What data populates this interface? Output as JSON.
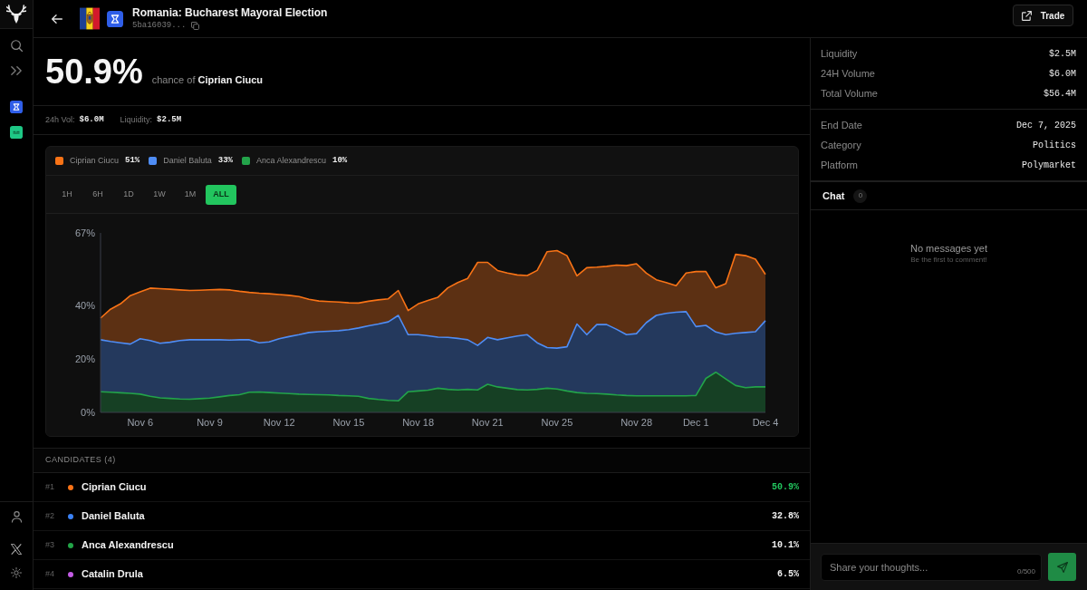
{
  "header": {
    "title": "Romania: Bucharest Mayoral Election",
    "market_id": "5ba16039...",
    "trade_button": "Trade"
  },
  "headline": {
    "probability": "50.9%",
    "caption": "chance of **Ciprian Ciucu**"
  },
  "summary": [
    {
      "label": "24h Vol:",
      "value": "$6.0M"
    },
    {
      "label": "Liquidity:",
      "value": "$2.5M"
    }
  ],
  "chart_card": {
    "legend": [
      {
        "value": "51%"
      },
      {
        "value": "33%"
      },
      {
        "value": "10%"
      }
    ],
    "ranges": [
      {
        "label": "1H",
        "selected": false
      },
      {
        "label": "6H",
        "selected": false
      },
      {
        "label": "1D",
        "selected": false
      },
      {
        "label": "1W",
        "selected": false
      },
      {
        "label": "1M",
        "selected": false
      },
      {
        "label": "ALL",
        "selected": true
      }
    ],
    "chart_data": {
      "type": "area",
      "categories": [
        null,
        null,
        null,
        null,
        "Nov 6",
        null,
        null,
        null,
        null,
        null,
        null,
        "Nov 9",
        null,
        null,
        null,
        null,
        null,
        null,
        "Nov 12",
        null,
        null,
        null,
        null,
        null,
        null,
        "Nov 15",
        null,
        null,
        null,
        null,
        null,
        null,
        "Nov 18",
        null,
        null,
        null,
        null,
        null,
        null,
        "Nov 21",
        null,
        null,
        null,
        null,
        null,
        null,
        "Nov 25",
        null,
        null,
        null,
        null,
        null,
        null,
        null,
        "Nov 28",
        null,
        null,
        null,
        null,
        null,
        "Dec 1",
        null,
        null,
        null,
        null,
        null,
        null,
        "Dec 4"
      ],
      "ylim": [
        0,
        67
      ],
      "yticks": [
        {
          "value": 0,
          "label": "0%"
        },
        {
          "value": 20,
          "label": "20%"
        },
        {
          "value": 40,
          "label": "40%"
        },
        {
          "value": 67,
          "label": "67%"
        }
      ],
      "series": [
        {
          "name": "Ciprian Ciucu",
          "color": "#f97316",
          "values": [
            35.2,
            38.5,
            40.5,
            43.6,
            45,
            46.4,
            46.2,
            46,
            45.7,
            45.5,
            45.6,
            45.8,
            45.9,
            45.7,
            45.2,
            44.8,
            44.5,
            44.3,
            44,
            43.7,
            43.2,
            42.2,
            41.6,
            41.4,
            41.2,
            40.9,
            40.8,
            41.5,
            42,
            42.4,
            45.5,
            38,
            40.5,
            41.8,
            43,
            46.5,
            48.5,
            50,
            56,
            56,
            53,
            52,
            51.3,
            51.1,
            53,
            60,
            60.4,
            58.5,
            51,
            54,
            54.2,
            54.5,
            55,
            54.8,
            55.5,
            52,
            49.5,
            48.5,
            47.3,
            52,
            52.6,
            52.6,
            46.5,
            48,
            59,
            58.5,
            57.2,
            51.5
          ]
        },
        {
          "name": "Daniel Baluta",
          "color": "#4f8df5",
          "values": [
            27.1,
            26.5,
            26,
            25.5,
            27.5,
            26.8,
            25.8,
            26.2,
            26.8,
            27.1,
            27.1,
            27.1,
            27.1,
            27,
            27.1,
            27.1,
            26,
            26.3,
            27.5,
            28.3,
            29,
            29.8,
            30.1,
            30.3,
            30.5,
            30.9,
            31.5,
            32.3,
            33,
            33.8,
            36.2,
            29,
            29,
            28.6,
            28.1,
            28,
            27.6,
            27.1,
            25,
            28,
            27.1,
            27.8,
            28.5,
            29,
            26,
            24.2,
            24,
            24.5,
            33,
            29,
            32.8,
            32.8,
            31,
            29,
            29.4,
            33.5,
            36.2,
            37,
            37.4,
            37.6,
            32,
            32.5,
            30,
            29,
            29.5,
            29.8,
            30.1,
            34.2
          ]
        },
        {
          "name": "Anca Alexandrescu",
          "color": "#23a34a",
          "values": [
            7.7,
            7.5,
            7.3,
            7.1,
            6.8,
            6,
            5.4,
            5.2,
            5,
            4.9,
            5.1,
            5.3,
            5.8,
            6.3,
            6.6,
            7.5,
            7.6,
            7.4,
            7.2,
            7,
            6.8,
            6.7,
            6.6,
            6.5,
            6.3,
            6.2,
            6,
            5.2,
            4.8,
            4.5,
            4.3,
            7.7,
            8,
            8.3,
            9,
            8.6,
            8.4,
            8.6,
            8.4,
            10.5,
            9.5,
            9,
            8.5,
            8.4,
            8.6,
            9,
            8.7,
            8,
            7.4,
            7.1,
            7,
            6.8,
            6.5,
            6.3,
            6.2,
            6.2,
            6.2,
            6.2,
            6.2,
            6.2,
            6.3,
            12.7,
            15,
            12.5,
            10,
            9.2,
            9.5,
            9.5
          ]
        }
      ]
    }
  },
  "candidates": {
    "title": "CANDIDATES (4)",
    "items": [
      {
        "rank": "#1",
        "name": "Ciprian Ciucu",
        "percent": "50.9%",
        "color": "#f97316",
        "leading": true
      },
      {
        "rank": "#2",
        "name": "Daniel Baluta",
        "percent": "32.8%",
        "color": "#3b82f6",
        "leading": false
      },
      {
        "rank": "#3",
        "name": "Anca Alexandrescu",
        "percent": "10.1%",
        "color": "#22a447",
        "leading": false
      },
      {
        "rank": "#4",
        "name": "Catalin Drula",
        "percent": "6.5%",
        "color": "#c45ce6",
        "leading": false
      }
    ]
  },
  "market_stats": [
    {
      "label": "Liquidity",
      "value": "$2.5M"
    },
    {
      "label": "24H Volume",
      "value": "$6.0M"
    },
    {
      "label": "Total Volume",
      "value": "$56.4M"
    }
  ],
  "market_info": [
    {
      "label": "End Date",
      "value": "Dec 7, 2025"
    },
    {
      "label": "Category",
      "value": "Politics"
    },
    {
      "label": "Platform",
      "value": "Polymarket"
    }
  ],
  "chat": {
    "title": "Chat",
    "count": "0",
    "empty_title": "No messages yet",
    "empty_hint": "Be the first to comment!",
    "input": {
      "placeholder": "Share your thoughts..."
    },
    "counter": "0/500"
  }
}
